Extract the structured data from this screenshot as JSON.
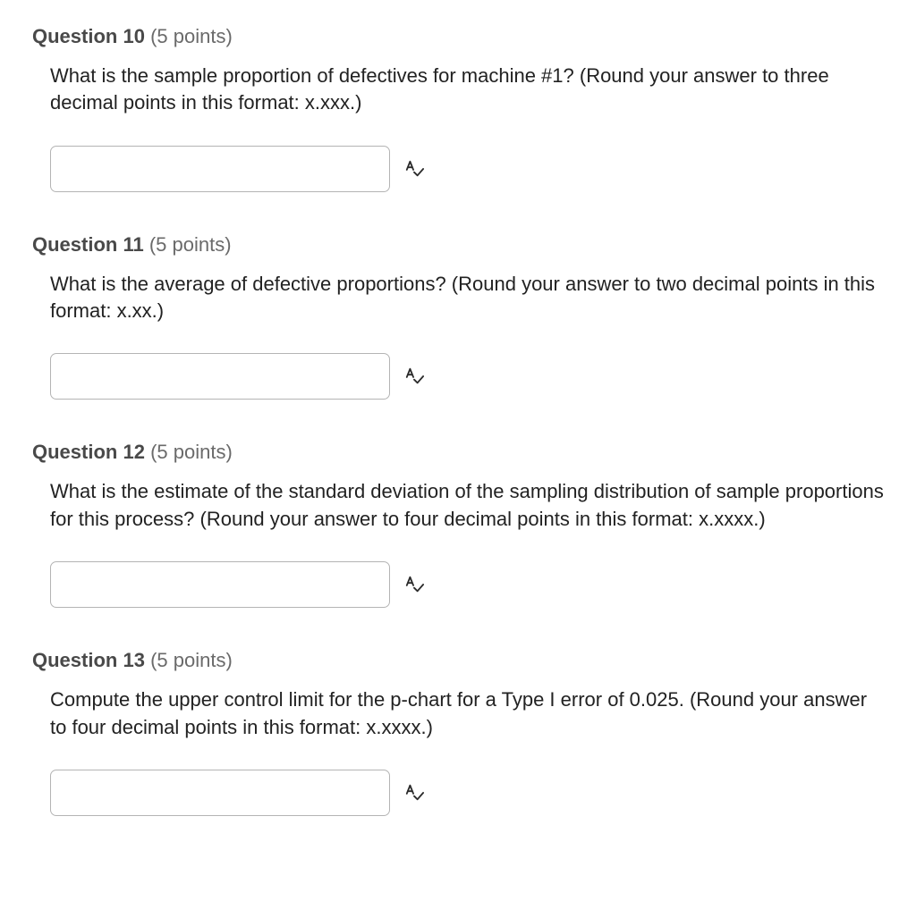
{
  "questions": [
    {
      "label_prefix": "Question",
      "number": "10",
      "points": "(5 points)",
      "text": "What is the sample proportion of defectives for machine #1? (Round your answer to three decimal points in this format: x.xxx.)",
      "answer_value": ""
    },
    {
      "label_prefix": "Question",
      "number": "11",
      "points": "(5 points)",
      "text": "What is the average of defective proportions? (Round your answer to two decimal points in this format: x.xx.)",
      "answer_value": ""
    },
    {
      "label_prefix": "Question",
      "number": "12",
      "points": "(5 points)",
      "text": "What is the estimate of the standard deviation of the sampling distribution of sample proportions for this process? (Round your answer to four decimal points in this format: x.xxxx.)",
      "answer_value": ""
    },
    {
      "label_prefix": "Question",
      "number": "13",
      "points": "(5 points)",
      "text": "Compute the upper control limit for the p-chart for a Type I error of 0.025. (Round your answer to four decimal points in this format: x.xxxx.)",
      "answer_value": ""
    }
  ]
}
